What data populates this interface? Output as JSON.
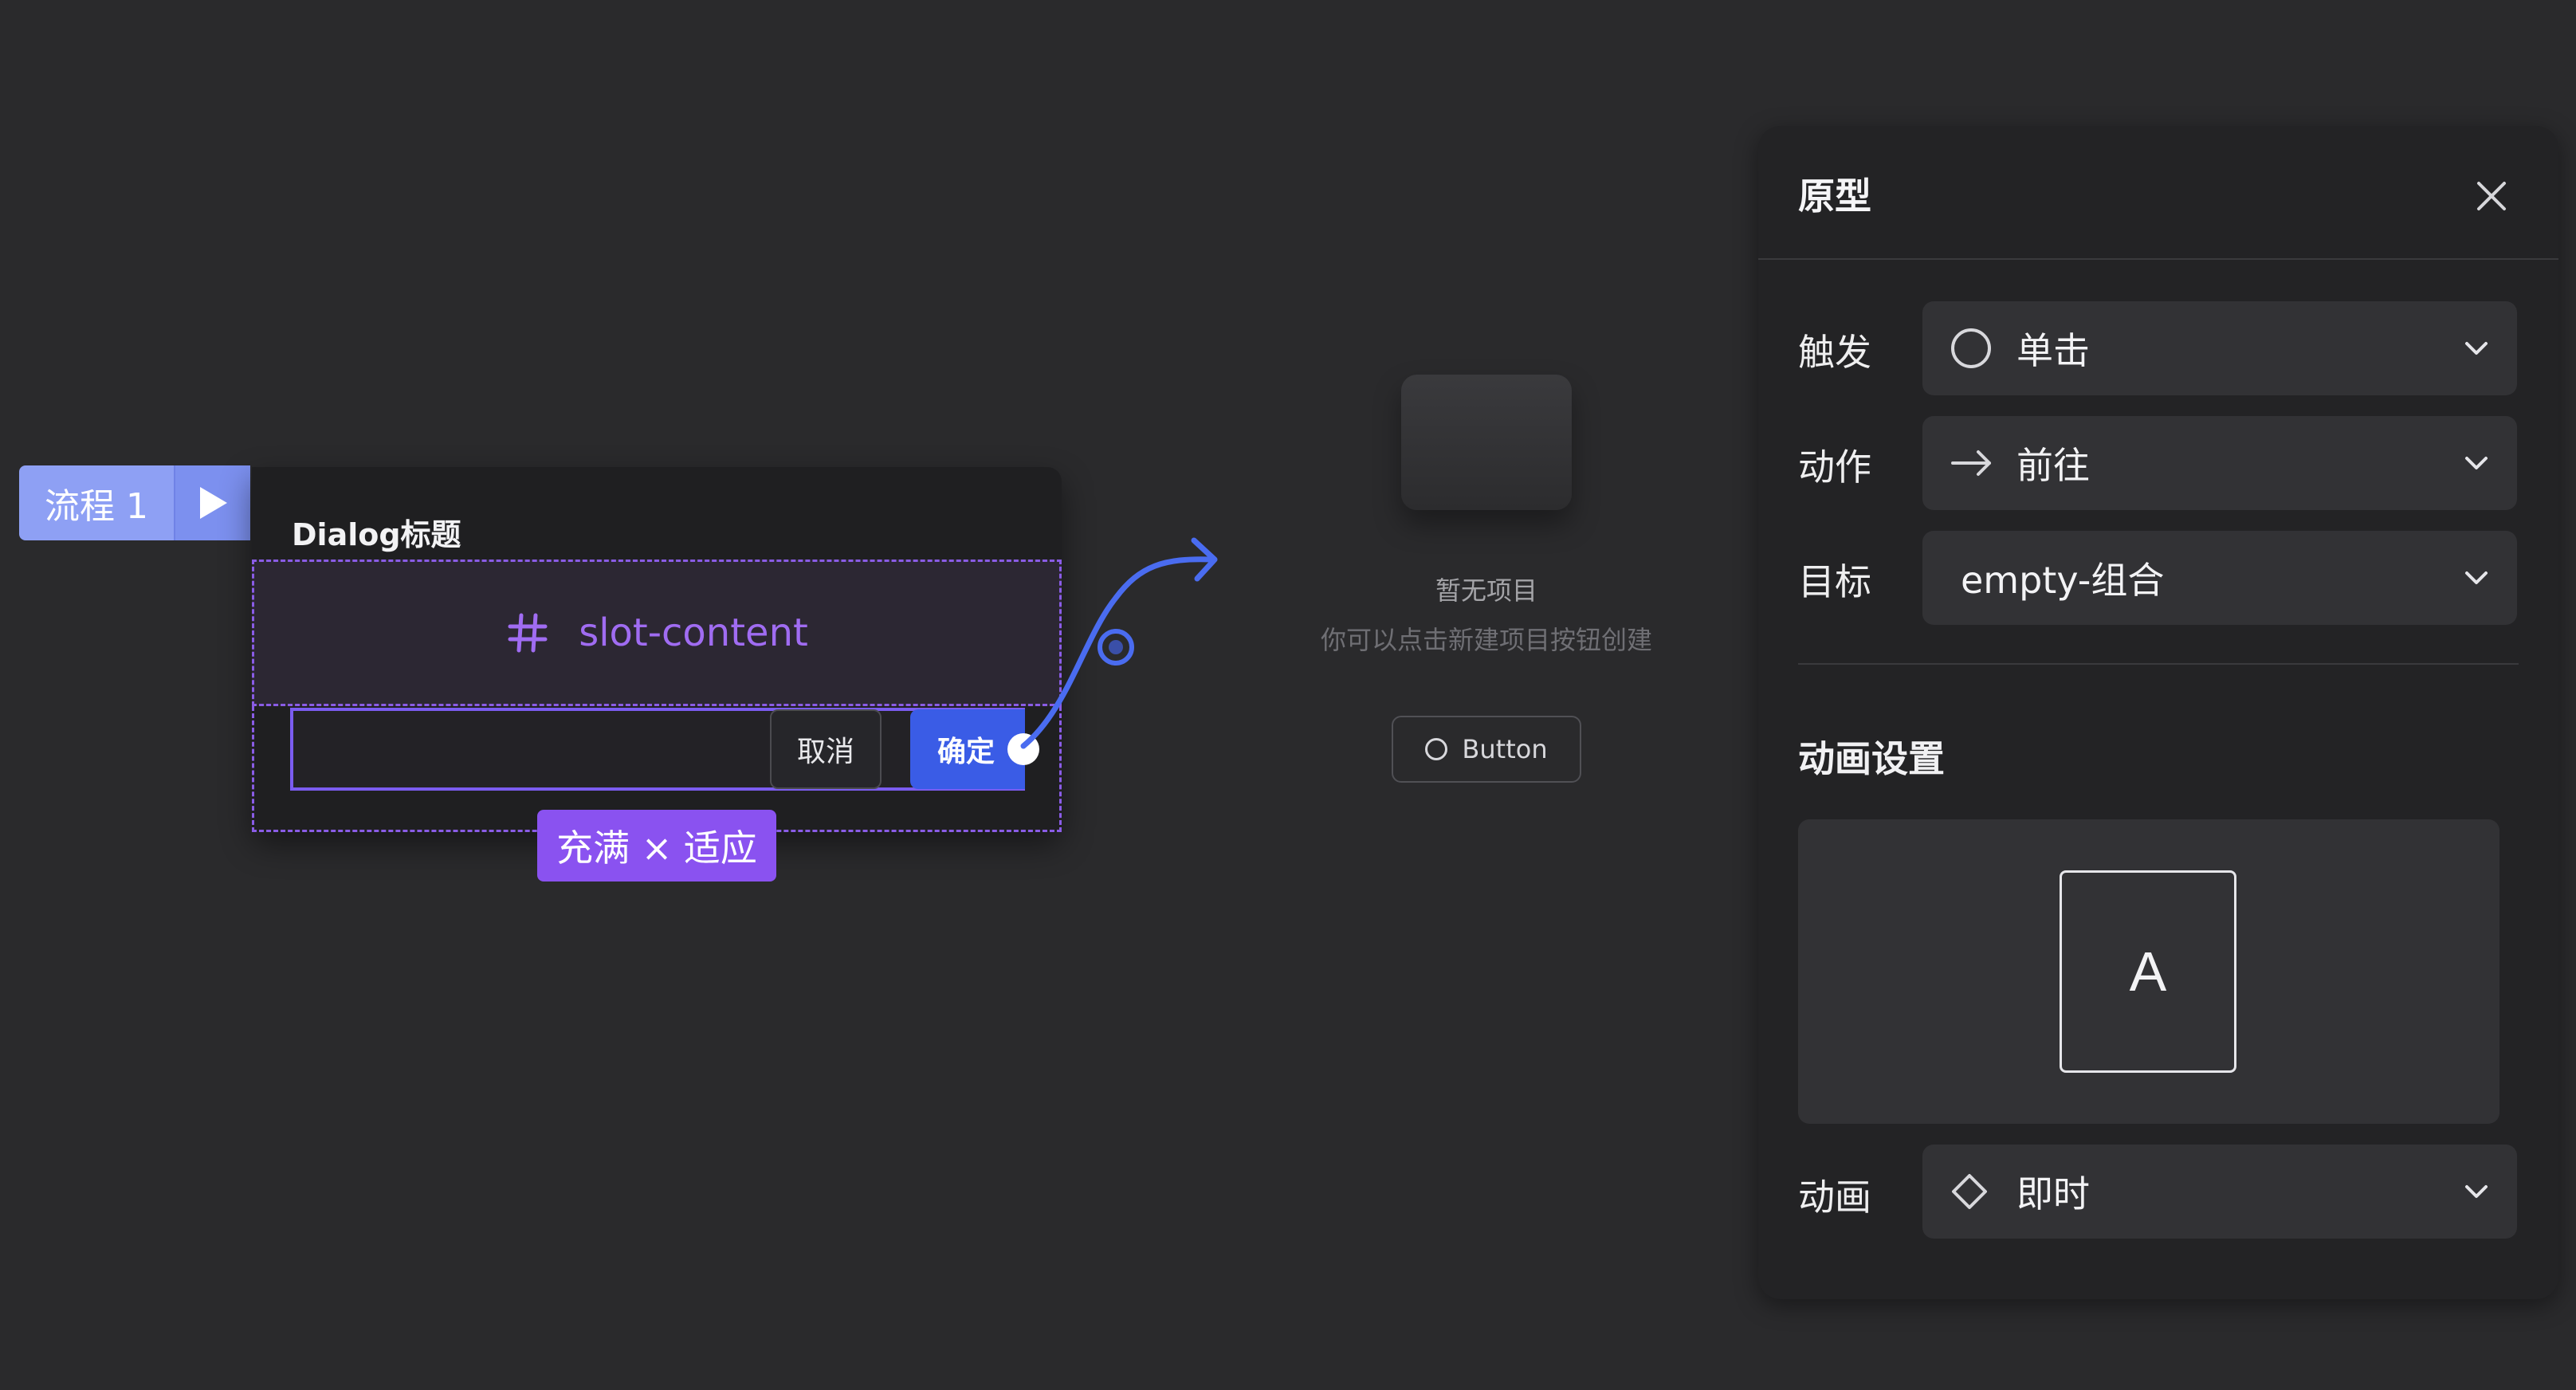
{
  "flow": {
    "label": "流程 1"
  },
  "dialog": {
    "title": "Dialog标题",
    "slot_label": "slot-content",
    "cancel_label": "取消",
    "confirm_label": "确定",
    "size_badge": "充满 × 适应"
  },
  "empty_state": {
    "title": "暂无项目",
    "subtitle": "你可以点击新建项目按钮创建",
    "button_label": "Button"
  },
  "panel": {
    "title": "原型",
    "trigger": {
      "label": "触发",
      "value": "单击",
      "icon": "circle-icon"
    },
    "action": {
      "label": "动作",
      "value": "前往",
      "icon": "arrow-right-icon"
    },
    "target": {
      "label": "目标",
      "value": "empty-组合"
    },
    "animation_section_title": "动画设置",
    "preview_letter": "A",
    "animation": {
      "label": "动画",
      "value": "即时",
      "icon": "diamond-icon"
    }
  },
  "colors": {
    "background": "#2a2a2c",
    "accent_purple": "#8a52f0",
    "accent_blue": "#3a5ce6",
    "flow_tag": "#8ea0f4"
  }
}
